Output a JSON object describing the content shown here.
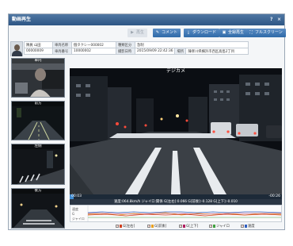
{
  "window": {
    "title": "動画再生",
    "help_glyph": "?",
    "close_glyph": "×"
  },
  "toolbar": [
    {
      "icon": "play-icon",
      "glyph": "▶",
      "label": "再生",
      "enabled": false
    },
    {
      "icon": "comment-icon",
      "glyph": "✎",
      "label": "コメント",
      "enabled": true
    },
    {
      "icon": "download-icon",
      "glyph": "⤓",
      "label": "ダウンロード",
      "enabled": true
    },
    {
      "icon": "all-play-icon",
      "glyph": "▣",
      "label": "全録再生",
      "enabled": true
    },
    {
      "icon": "fullscreen-icon",
      "glyph": "⛶",
      "label": "フルスクリーン",
      "enabled": true
    }
  ],
  "info": {
    "row1": {
      "name_label": "隊員 山田",
      "vehicle_label": "車両名称",
      "vehicle_value": "個タクシー000002",
      "type_label": "種類区分",
      "type_value": "急制"
    },
    "row2": {
      "id_value": "00000009",
      "number_label": "車両番号",
      "number_value": "10000002",
      "datetime_label": "撮影日時",
      "datetime_value": "2015/09/09 22:42:36",
      "place_label": "場所",
      "place_value": "陳孝川県横浜市西区高島2丁目"
    }
  },
  "side_cameras": [
    {
      "label": "車内"
    },
    {
      "label": "前方"
    },
    {
      "label": "左側"
    },
    {
      "label": "後方"
    }
  ],
  "video": {
    "label": "デジカメ"
  },
  "playback": {
    "current": "00:03",
    "remaining": "-00:26",
    "progress": 0.02
  },
  "status": {
    "text": "速度:064.8km/h    ジャイロ:関係    G[左右]:0.066    G[前後]:-0.128    G[上下]:-0.010"
  },
  "graph": {
    "y_labels": [
      "速度",
      "G",
      "ジャイロ"
    ],
    "series": [
      {
        "name": "G[左右]",
        "color": "#d04020",
        "checked": true
      },
      {
        "name": "G[前後]",
        "color": "#e8a020",
        "checked": true
      },
      {
        "name": "G[上下]",
        "color": "#b02060",
        "checked": true
      },
      {
        "name": "ジャイロ",
        "color": "#40a040",
        "checked": true
      },
      {
        "name": "速度",
        "color": "#3060c0",
        "checked": true
      }
    ]
  }
}
